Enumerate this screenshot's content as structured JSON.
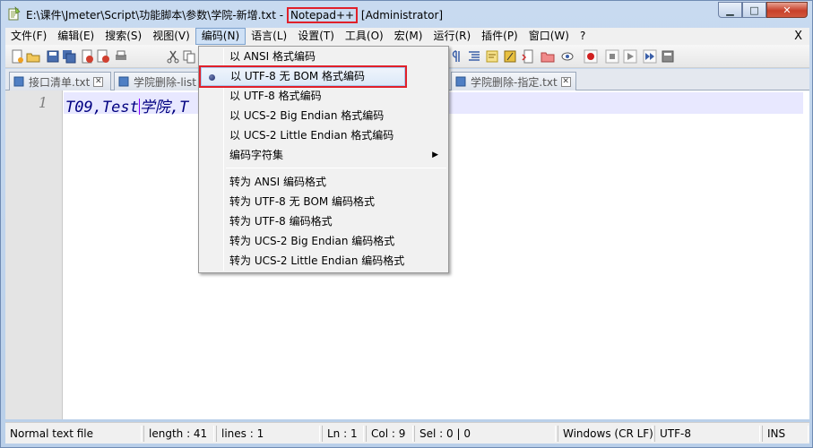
{
  "window": {
    "title_path": "E:\\课件\\Jmeter\\Script\\功能脚本\\参数\\学院-新增.txt -",
    "title_app": "Notepad++",
    "title_suffix": "[Administrator]",
    "minimize_glyph": "▁",
    "maximize_glyph": "□",
    "close_glyph": "✕"
  },
  "menubar": {
    "items": [
      {
        "label": "文件(F)"
      },
      {
        "label": "编辑(E)"
      },
      {
        "label": "搜索(S)"
      },
      {
        "label": "视图(V)"
      },
      {
        "label": "编码(N)",
        "active": true
      },
      {
        "label": "语言(L)"
      },
      {
        "label": "设置(T)"
      },
      {
        "label": "工具(O)"
      },
      {
        "label": "宏(M)"
      },
      {
        "label": "运行(R)"
      },
      {
        "label": "插件(P)"
      },
      {
        "label": "窗口(W)"
      },
      {
        "label": "?"
      }
    ],
    "close_label": "X"
  },
  "toolbar": {
    "icons": [
      "new-file-icon",
      "open-file-icon",
      "save-icon",
      "save-all-icon",
      "close-file-icon",
      "close-all-icon",
      "print-icon",
      "cut-icon",
      "copy-icon",
      "paragraph-icon",
      "indent-guide-icon",
      "doc-map-icon",
      "function-list-icon",
      "doc-switcher-icon",
      "folder-icon",
      "monitor-icon",
      "record-macro-icon",
      "stop-macro-icon",
      "play-macro-icon",
      "run-macro-multiple-icon",
      "save-macro-icon"
    ]
  },
  "tabs": [
    {
      "label": "接口清单.txt"
    },
    {
      "label": "学院删除-list"
    },
    {
      "label": "学院删除-指定.txt"
    }
  ],
  "editor": {
    "line_number": "1",
    "text_before_caret": "T09,Test",
    "text_after_caret": "学院,T"
  },
  "encoding_menu": {
    "items": [
      {
        "label": "以 ANSI 格式编码"
      },
      {
        "label": "以 UTF-8 无 BOM 格式编码",
        "selected": true
      },
      {
        "label": "以 UTF-8 格式编码"
      },
      {
        "label": "以 UCS-2 Big Endian 格式编码"
      },
      {
        "label": "以 UCS-2 Little Endian 格式编码"
      },
      {
        "label": "编码字符集",
        "submenu": true
      },
      {
        "label": "转为 ANSI 编码格式"
      },
      {
        "label": "转为 UTF-8 无 BOM 编码格式"
      },
      {
        "label": "转为 UTF-8 编码格式"
      },
      {
        "label": "转为 UCS-2 Big Endian 编码格式"
      },
      {
        "label": "转为 UCS-2 Little Endian 编码格式"
      }
    ],
    "submenu_arrow": "▶"
  },
  "statusbar": {
    "file_type": "Normal text file",
    "length": "length : 41",
    "lines": "lines : 1",
    "ln": "Ln : 1",
    "col": "Col : 9",
    "sel": "Sel : 0 | 0",
    "eol": "Windows (CR LF)",
    "encoding": "UTF-8",
    "mode": "INS"
  },
  "colors": {
    "highlight_box": "#e0202a",
    "code_text": "#000080",
    "caret": "#8000ff",
    "current_line": "#e8e8ff"
  }
}
